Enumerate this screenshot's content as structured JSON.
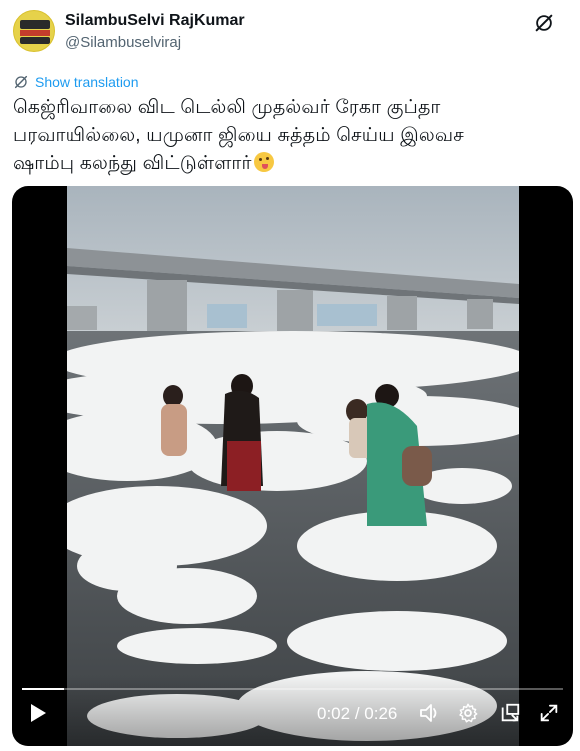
{
  "author": {
    "display_name": "SilambuSelvi RajKumar",
    "handle": "@Silambuselviraj"
  },
  "translation": {
    "label": "Show translation"
  },
  "tweet": {
    "lines": [
      "கெஜ்ரிவாலை விட டெல்லி முதல்வர் ரேகா குப்தா",
      "பரவாயில்லை, யமுனா ஜியை சுத்தம் செய்ய இலவச",
      "ஷாம்பு கலந்து விட்டுள்ளார்"
    ],
    "emoji": "winking-face-with-tongue"
  },
  "video": {
    "current_time": "0:02",
    "separator": "/",
    "duration": "0:26",
    "progress_fraction": 0.077
  },
  "colors": {
    "accent": "#1d9bf0",
    "text": "#0f1419",
    "secondary": "#536471"
  }
}
